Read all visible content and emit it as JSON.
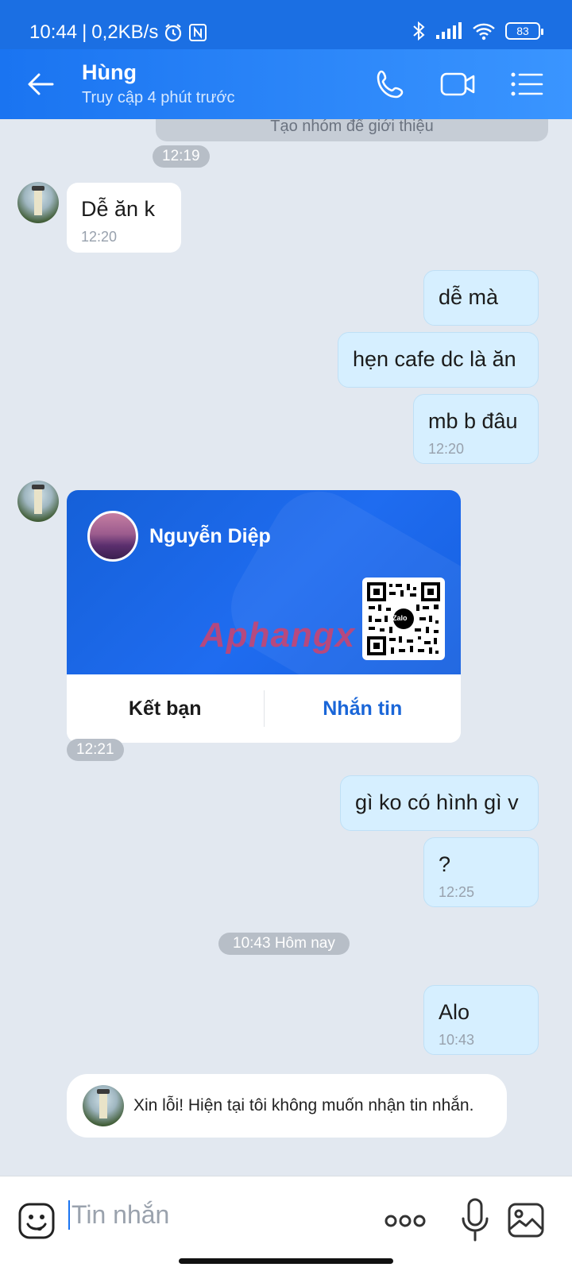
{
  "status_bar": {
    "time": "10:44",
    "speed": "0,2KB/s",
    "battery": "83",
    "icons": [
      "alarm-icon",
      "nfc-icon",
      "bluetooth-icon",
      "signal-icon",
      "wifi-icon",
      "battery-icon"
    ]
  },
  "header": {
    "contact_name": "Hùng",
    "last_seen": "Truy cập 4 phút trước",
    "icons": [
      "back-arrow-icon",
      "phone-icon",
      "video-call-icon",
      "menu-icon"
    ]
  },
  "chat": {
    "system_partial": "Tạo nhóm để giới thiệu",
    "pill_1219": "12:19",
    "msg_in_1": {
      "text": "Dễ ăn k",
      "time": "12:20"
    },
    "msg_out_1": {
      "text": "dễ mà"
    },
    "msg_out_2": {
      "text": "hẹn cafe dc là ăn"
    },
    "msg_out_3": {
      "text": "mb b đâu",
      "time": "12:20"
    },
    "contact_card": {
      "name": "Nguyễn Diệp",
      "watermark": "Aphangx",
      "qr_logo": "Zalo",
      "add_friend": "Kết bạn",
      "message": "Nhắn tin"
    },
    "pill_1221": "12:21",
    "msg_out_4": {
      "text": "gì ko có hình gì v"
    },
    "msg_out_5": {
      "text": "?",
      "time": "12:25"
    },
    "pill_today": "10:43 Hôm nay",
    "msg_out_6": {
      "text": "Alo",
      "time": "10:43"
    },
    "auto_reply": "Xin lỗi! Hiện tại tôi không muốn nhận tin nhắn."
  },
  "input": {
    "placeholder": "Tin nhắn",
    "icons": [
      "sticker-icon",
      "more-icon",
      "microphone-icon",
      "image-icon"
    ]
  },
  "colors": {
    "header_blue": "#1a74f1",
    "bubble_out": "#d6efff",
    "bubble_in": "#ffffff",
    "background": "#e2e8f0",
    "link_blue": "#1a66d8"
  }
}
